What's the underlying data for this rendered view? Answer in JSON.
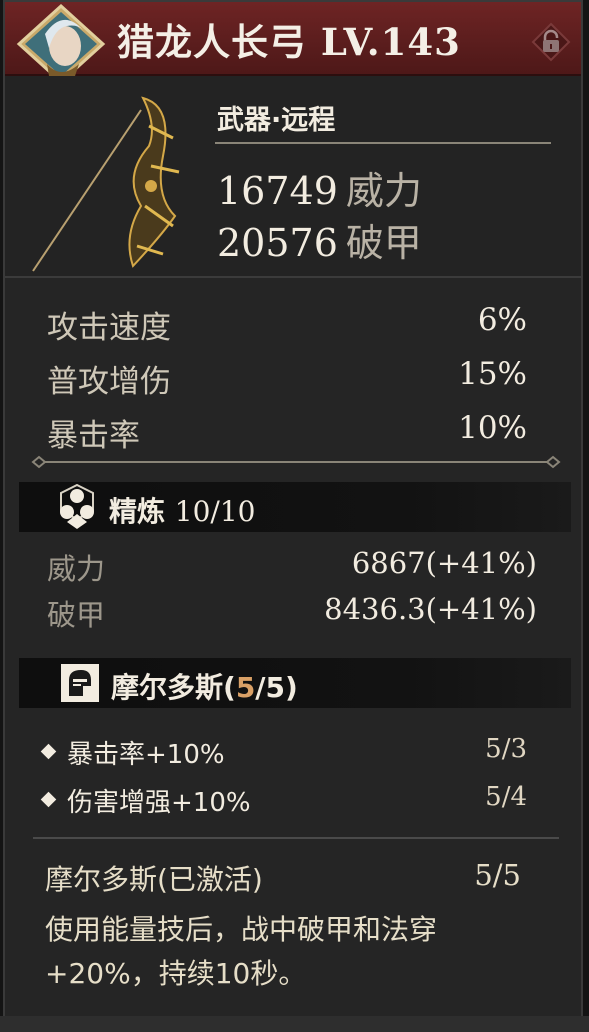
{
  "header": {
    "title": "猎龙人长弓 LV.143",
    "lock_icon": "padlock-icon"
  },
  "weapon": {
    "type": "武器·远程",
    "stats": [
      {
        "value": "16749",
        "label": "威力"
      },
      {
        "value": "20576",
        "label": "破甲"
      }
    ]
  },
  "attributes": [
    {
      "label": "攻击速度",
      "value": "6%"
    },
    {
      "label": "普攻增伤",
      "value": "15%"
    },
    {
      "label": "暴击率",
      "value": "10%"
    }
  ],
  "refine": {
    "label": "精炼",
    "progress": "10/10",
    "icon": "refine-gems-icon",
    "rows": [
      {
        "label": "威力",
        "value": "6867(+41%)"
      },
      {
        "label": "破甲",
        "value": "8436.3(+41%)"
      }
    ]
  },
  "set": {
    "name": "摩尔多斯(",
    "current": "5",
    "rest": "/5)",
    "icon": "knight-helmet-icon",
    "effects": [
      {
        "label": "暴击率+10%",
        "value": "5/3"
      },
      {
        "label": "伤害增强+10%",
        "value": "5/4"
      }
    ],
    "active_title": "摩尔多斯(已激活)",
    "active_count": "5/5",
    "active_desc": "使用能量技后，战中破甲和法穿+20%，持续10秒。"
  },
  "colors": {
    "header_bg": "#6e2424",
    "highlight": "#d9a066",
    "panel_bg": "#252525"
  }
}
